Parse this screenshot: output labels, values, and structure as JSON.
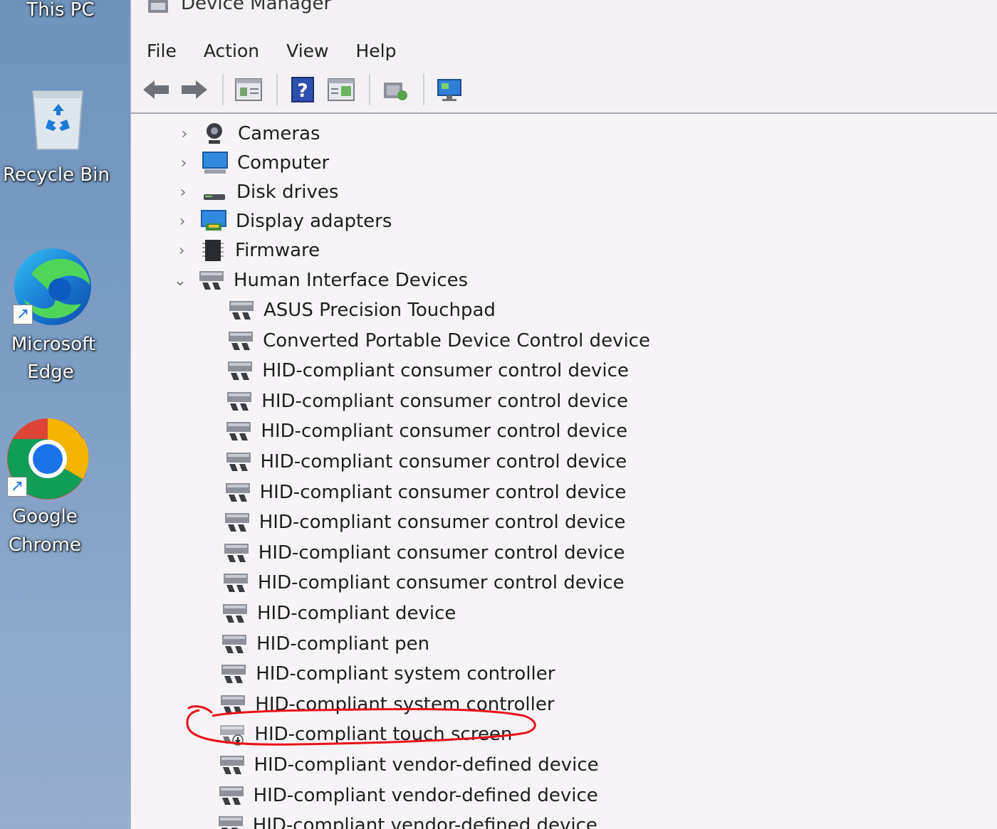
{
  "desktop": {
    "this_pc": "This PC",
    "recycle_bin": "Recycle Bin",
    "edge_line1": "Microsoft",
    "edge_line2": "Edge",
    "chrome_line1": "Google",
    "chrome_line2": "Chrome"
  },
  "window": {
    "title": "Device Manager",
    "menu": [
      "File",
      "Action",
      "View",
      "Help"
    ],
    "toolbar_icons": [
      "back-arrow-icon",
      "forward-arrow-icon",
      "properties-icon",
      "help-icon",
      "update-driver-icon",
      "scan-hardware-icon",
      "monitor-icon"
    ]
  },
  "tree": {
    "categories": [
      {
        "label": "Cameras",
        "icon": "camera-icon",
        "expanded": false
      },
      {
        "label": "Computer",
        "icon": "computer-icon",
        "expanded": false
      },
      {
        "label": "Disk drives",
        "icon": "disk-drive-icon",
        "expanded": false
      },
      {
        "label": "Display adapters",
        "icon": "display-adapter-icon",
        "expanded": false
      },
      {
        "label": "Firmware",
        "icon": "firmware-icon",
        "expanded": false
      },
      {
        "label": "Human Interface Devices",
        "icon": "hid-icon",
        "expanded": true
      }
    ],
    "hid_devices": [
      "ASUS Precision Touchpad",
      "Converted Portable Device Control device",
      "HID-compliant consumer control device",
      "HID-compliant consumer control device",
      "HID-compliant consumer control device",
      "HID-compliant consumer control device",
      "HID-compliant consumer control device",
      "HID-compliant consumer control device",
      "HID-compliant consumer control device",
      "HID-compliant consumer control device",
      "HID-compliant device",
      "HID-compliant pen",
      "HID-compliant system controller",
      "HID-compliant system controller",
      "HID-compliant touch screen",
      "HID-compliant vendor-defined device",
      "HID-compliant vendor-defined device",
      "HID-compliant vendor-defined device"
    ],
    "disabled_device_index": 14
  },
  "colors": {
    "annotation": "#e8101a",
    "accent_blue": "#1e88e5"
  }
}
